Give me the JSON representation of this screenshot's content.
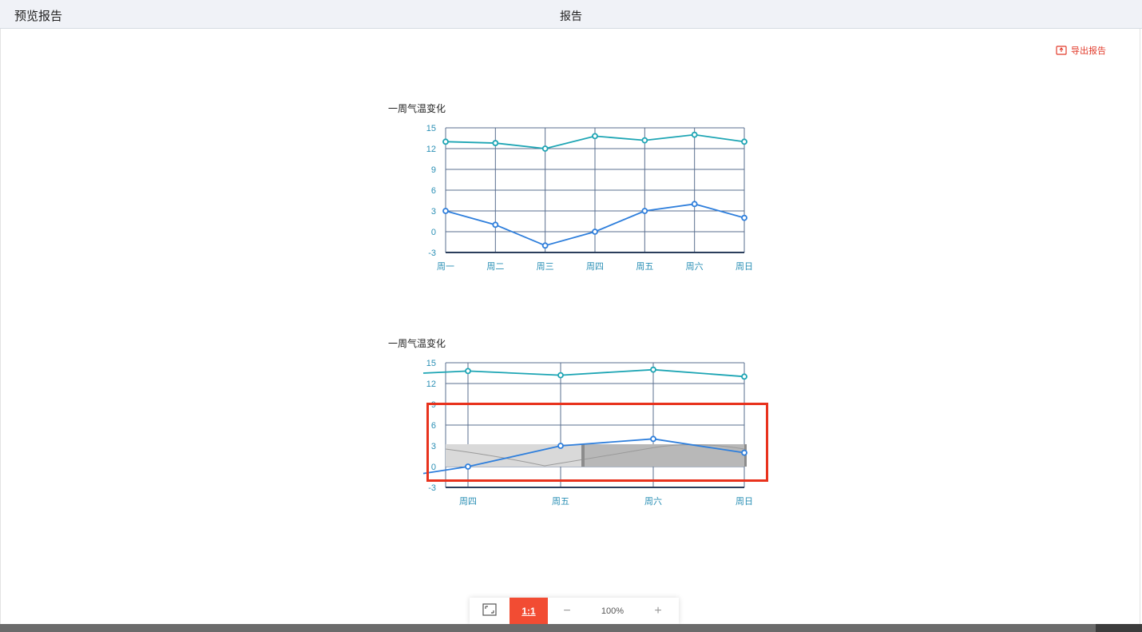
{
  "header": {
    "left_title": "预览报告",
    "center_title": "报告"
  },
  "toolbar": {
    "export_label": "导出报告",
    "export_icon": "export-document-icon"
  },
  "colors": {
    "accent": "#f24c33",
    "series_high": "#1da5b4",
    "series_low": "#2f7fdc",
    "grid": "#5a6f8f",
    "highlight": "#e8321d"
  },
  "charts": [
    {
      "title": "一周气温变化"
    },
    {
      "title": "一周气温变化"
    }
  ],
  "chart_data": [
    {
      "type": "line",
      "title": "一周气温变化",
      "categories": [
        "周一",
        "周二",
        "周三",
        "周四",
        "周五",
        "周六",
        "周日"
      ],
      "series": [
        {
          "values": [
            13,
            12.8,
            12,
            13.8,
            13.2,
            14,
            13
          ]
        },
        {
          "values": [
            3,
            1,
            -2,
            0,
            3,
            4,
            2
          ]
        }
      ],
      "ylim": [
        -3,
        15
      ],
      "yticks": [
        15,
        12,
        9,
        6,
        3,
        0,
        -3
      ],
      "grid": true
    },
    {
      "type": "line",
      "title": "一周气温变化",
      "categories": [
        "周四",
        "周五",
        "周六",
        "周日"
      ],
      "series": [
        {
          "values": [
            13.8,
            13.2,
            14,
            13
          ]
        },
        {
          "values": [
            0,
            3,
            4,
            2
          ]
        }
      ],
      "ylim": [
        -3,
        15
      ],
      "yticks": [
        15,
        12,
        9,
        6,
        3,
        0,
        -3
      ],
      "grid": true,
      "data_zoom": true
    }
  ],
  "zoom": {
    "fit_icon": "fit-screen-icon",
    "actual_label": "1:1",
    "minus_label": "−",
    "level": "100%",
    "plus_label": "+"
  }
}
